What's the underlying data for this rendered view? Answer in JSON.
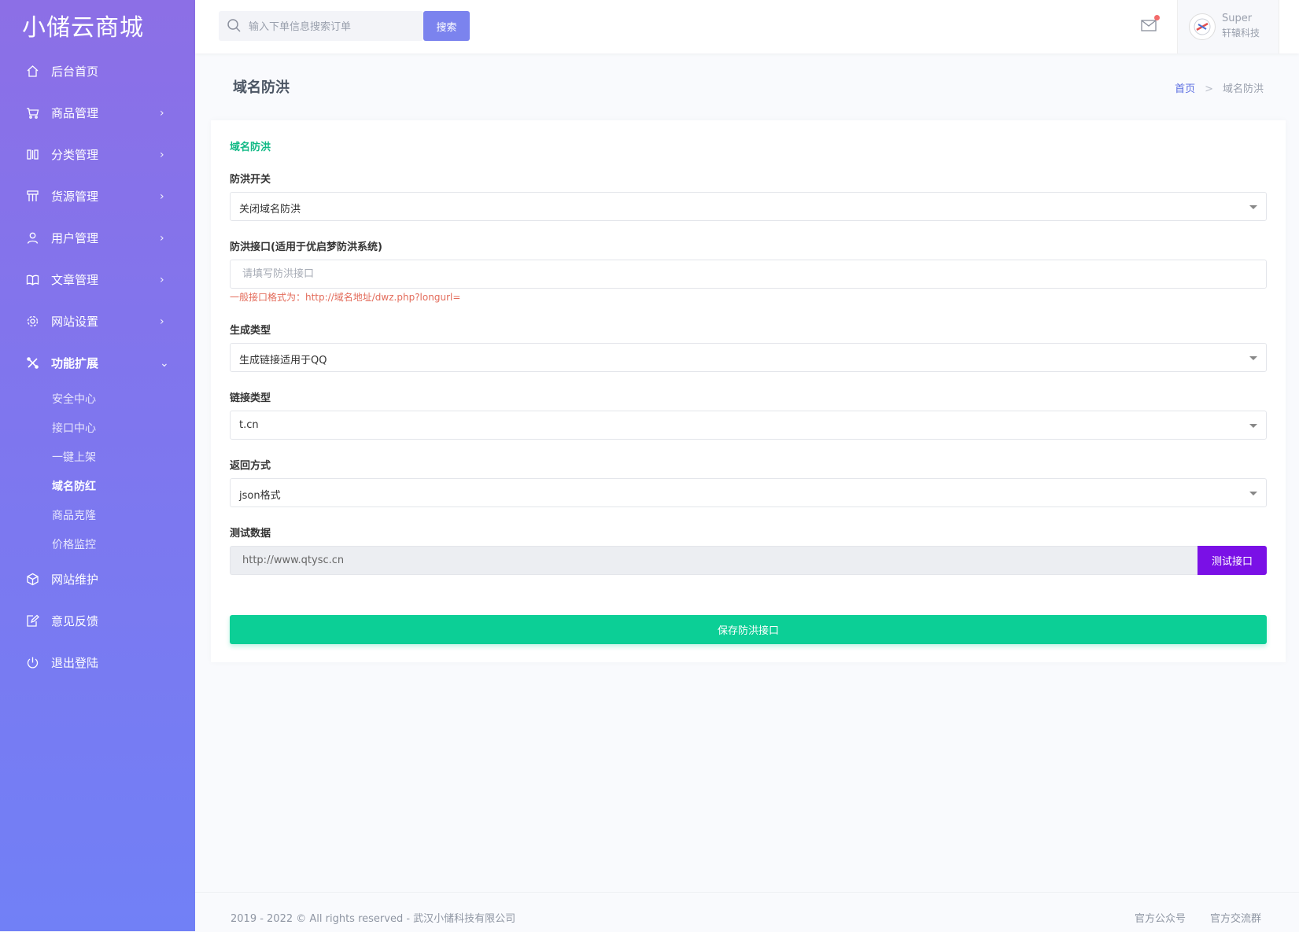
{
  "app": {
    "logo": "小储云商城"
  },
  "sidebar": {
    "items": [
      {
        "icon": "home-icon",
        "label": "后台首页",
        "chevron": ""
      },
      {
        "icon": "cart-icon",
        "label": "商品管理",
        "chevron": "›"
      },
      {
        "icon": "columns-icon",
        "label": "分类管理",
        "chevron": "›"
      },
      {
        "icon": "grid-icon",
        "label": "货源管理",
        "chevron": "›"
      },
      {
        "icon": "user-icon",
        "label": "用户管理",
        "chevron": "›"
      },
      {
        "icon": "book-icon",
        "label": "文章管理",
        "chevron": "›"
      },
      {
        "icon": "gear-icon",
        "label": "网站设置",
        "chevron": "›"
      },
      {
        "icon": "tools-icon",
        "label": "功能扩展",
        "chevron": "⌄"
      },
      {
        "icon": "box-icon",
        "label": "网站维护",
        "chevron": ""
      },
      {
        "icon": "feedback-icon",
        "label": "意见反馈",
        "chevron": ""
      },
      {
        "icon": "power-icon",
        "label": "退出登陆",
        "chevron": ""
      }
    ],
    "submenu": [
      {
        "label": "安全中心"
      },
      {
        "label": "接口中心"
      },
      {
        "label": "一键上架"
      },
      {
        "label": "域名防红"
      },
      {
        "label": "商品克隆"
      },
      {
        "label": "价格监控"
      }
    ]
  },
  "topbar": {
    "search_placeholder": "输入下单信息搜索订单",
    "search_button": "搜索",
    "user_name": "Super",
    "user_org": "轩辕科技"
  },
  "page": {
    "title": "域名防洪",
    "breadcrumb_home": "首页",
    "breadcrumb_sep": ">",
    "breadcrumb_current": "域名防洪"
  },
  "form": {
    "card_title": "域名防洪",
    "switch_label": "防洪开关",
    "switch_value": "关闭域名防洪",
    "api_label": "防洪接口(适用于优启梦防洪系统)",
    "api_placeholder": "请填写防洪接口",
    "api_hint": "一般接口格式为：http://域名地址/dwz.php?longurl=",
    "gen_type_label": "生成类型",
    "gen_type_value": "生成链接适用于QQ",
    "link_type_label": "链接类型",
    "link_type_value": "t.cn",
    "return_label": "返回方式",
    "return_value": "json格式",
    "test_label": "测试数据",
    "test_value": "http://www.qtysc.cn",
    "test_button": "测试接口",
    "save_button": "保存防洪接口"
  },
  "footer": {
    "copyright": "2019 - 2022 © All rights reserved - 武汉小储科技有限公司",
    "link1": "官方公众号",
    "link2": "官方交流群"
  },
  "colors": {
    "sidebar_top": "#8c6fe6",
    "sidebar_bottom": "#7180f6",
    "accent_green": "#0ccf96",
    "test_button": "#7a10e6",
    "search_button": "#7b83ee",
    "hint_red": "#e36b5a"
  }
}
